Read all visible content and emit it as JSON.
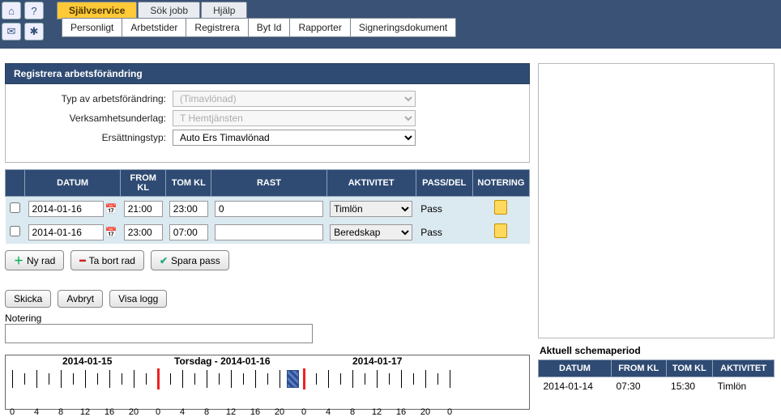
{
  "top_icons": [
    "⌂",
    "?",
    "✉",
    "✱"
  ],
  "tabs1": [
    {
      "label": "Självservice",
      "active": true
    },
    {
      "label": "Sök jobb",
      "active": false
    },
    {
      "label": "Hjälp",
      "active": false
    }
  ],
  "tabs2": [
    "Personligt",
    "Arbetstider",
    "Registrera",
    "Byt Id",
    "Rapporter",
    "Signeringsdokument"
  ],
  "panel_title": "Registrera arbetsförändring",
  "form": {
    "typ_label": "Typ av arbetsförändring:",
    "typ_value": "(Timavlönad)",
    "verksamhet_label": "Verksamhetsunderlag:",
    "verksamhet_value": "T Hemtjänsten",
    "ersattning_label": "Ersättningstyp:",
    "ersattning_value": "Auto Ers Timavlönad"
  },
  "grid_headers": [
    "",
    "DATUM",
    "FROM KL",
    "TOM KL",
    "RAST",
    "AKTIVITET",
    "PASS/DEL",
    "NOTERING"
  ],
  "rows": [
    {
      "datum": "2014-01-16",
      "from": "21:00",
      "tom": "23:00",
      "rast": "0",
      "aktivitet": "Timlön",
      "passdel": "Pass"
    },
    {
      "datum": "2014-01-16",
      "from": "23:00",
      "tom": "07:00",
      "rast": "",
      "aktivitet": "Beredskap",
      "passdel": "Pass"
    }
  ],
  "buttons": {
    "ny_rad": "Ny rad",
    "ta_bort": "Ta bort rad",
    "spara": "Spara pass",
    "skicka": "Skicka",
    "avbryt": "Avbryt",
    "visa_logg": "Visa logg"
  },
  "notering_label": "Notering",
  "timeline": {
    "day1": "2014-01-15",
    "day2": "Torsdag - 2014-01-16",
    "day3": "2014-01-17",
    "hours": [
      0,
      4,
      8,
      12,
      16,
      20,
      0,
      4,
      8,
      12,
      16,
      20,
      0,
      4,
      8,
      12,
      16,
      20,
      0
    ]
  },
  "right": {
    "header": "Aktuell schemaperiod",
    "cols": [
      "DATUM",
      "FROM KL",
      "TOM KL",
      "AKTIVITET"
    ],
    "row": {
      "datum": "2014-01-14",
      "from": "07:30",
      "tom": "15:30",
      "aktivitet": "Timlön"
    }
  }
}
